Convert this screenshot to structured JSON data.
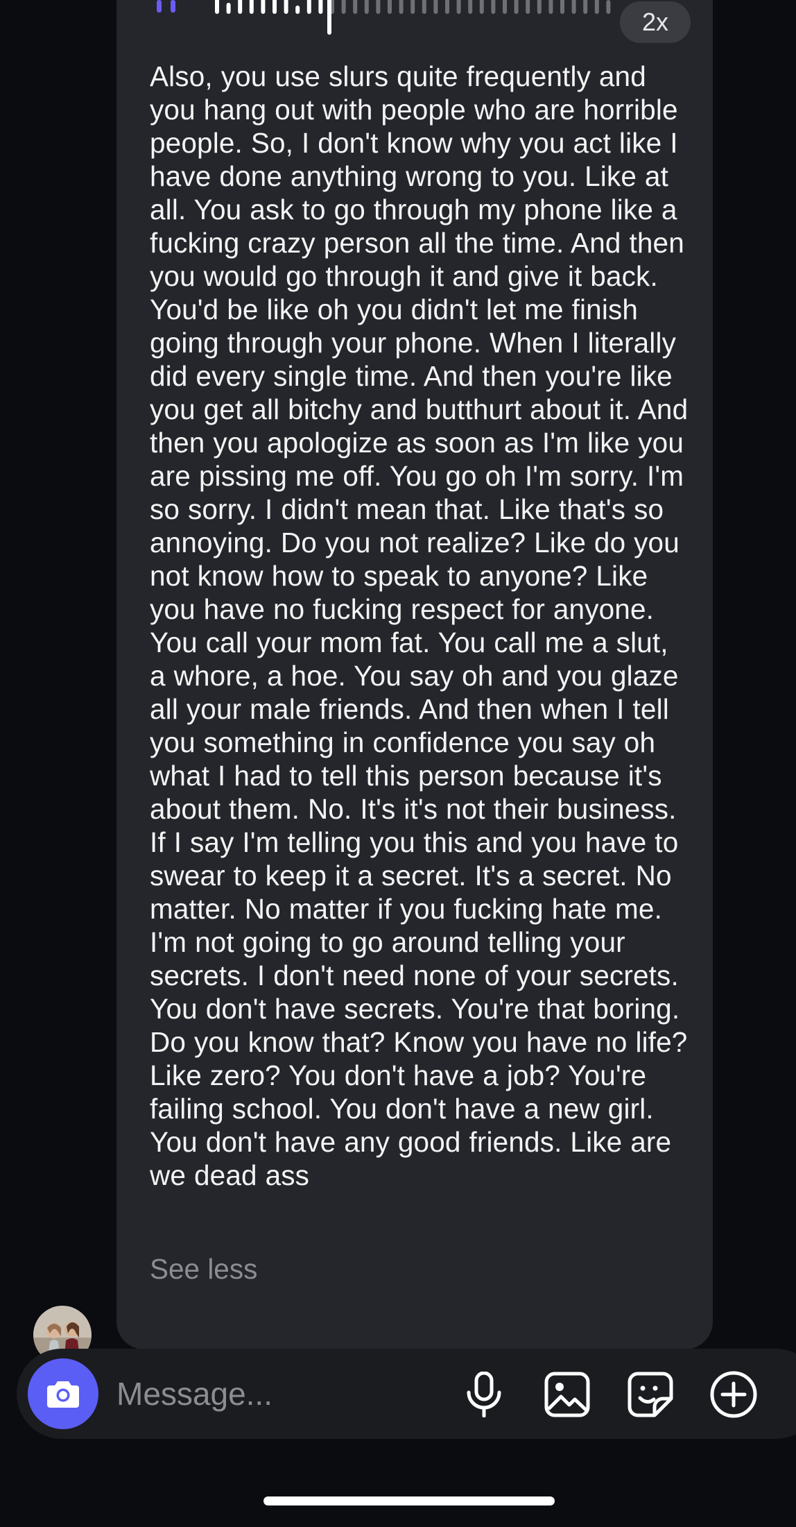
{
  "voice_message": {
    "playback_speed": "2x",
    "progress": 0.28,
    "transcript": "Also, you use slurs quite frequently and you hang out with people who are horrible people. So, I don't know why you act like I have done anything wrong to you. Like at all. You ask to go through my phone like a fucking crazy person all the time. And then you would go through it and give it back. You'd be like oh you didn't let me finish going through your phone. When I literally did every single time. And then you're like you get all bitchy and butthurt about it. And then you apologize as soon as I'm like you are pissing me off. You go oh I'm sorry. I'm so sorry. I didn't mean that. Like that's so annoying. Do you not realize? Like do you not know how to speak to anyone? Like you have no fucking respect for anyone. You call your mom fat. You call me a slut, a whore, a hoe. You say oh and you glaze all your male friends. And then when I tell you something in confidence you say oh what I had to tell this person because it's about them. No. It's it's not their business. If I say I'm telling you this and you have to swear to keep it a secret. It's a secret. No matter. No matter if you fucking hate me. I'm not going to go around telling your secrets. I don't need none of your secrets. You don't have secrets. You're that boring. Do you know that? Know you have no life? Like zero? You don't have a job? You're failing school. You don't have a new girl. You don't have any good friends. Like are we dead ass",
    "see_less_label": "See less"
  },
  "composer": {
    "placeholder": "Message..."
  },
  "icons": {
    "camera": "camera-icon",
    "microphone": "microphone-icon",
    "gallery": "image-icon",
    "sticker": "sticker-icon",
    "more": "plus-circle-icon"
  },
  "colors": {
    "background": "#0b0c10",
    "bubble": "#25262b",
    "accent": "#5b5ef4",
    "text": "#f4f4f5",
    "muted_text": "#8c8d92"
  }
}
